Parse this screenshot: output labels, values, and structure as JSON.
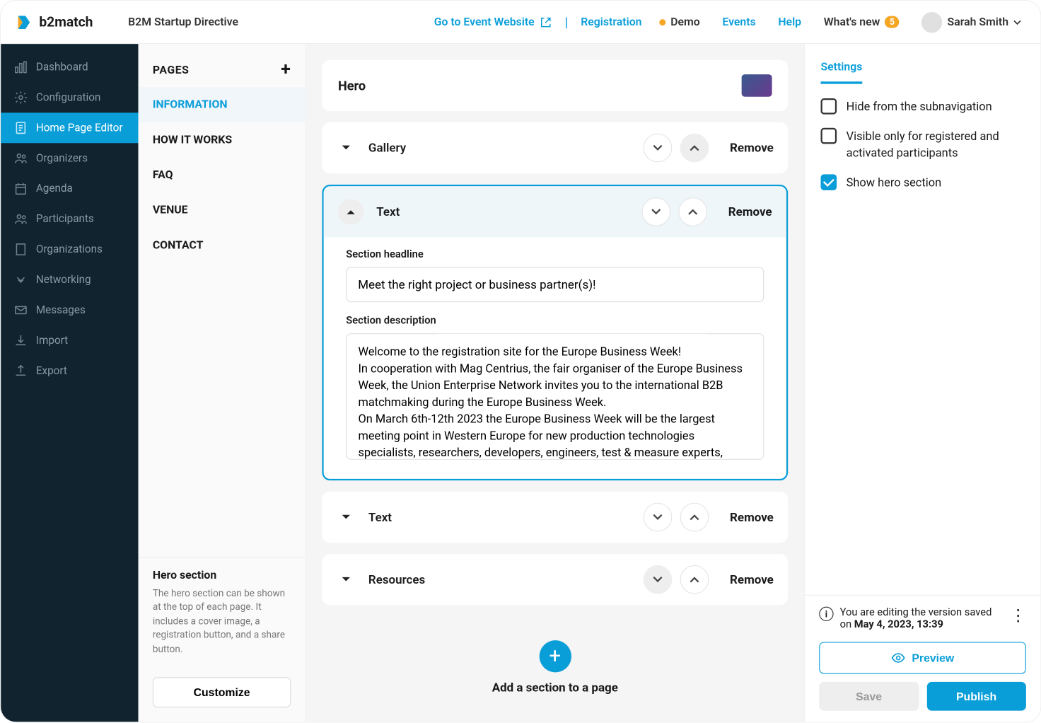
{
  "topbar": {
    "brand": "b2match",
    "event_title": "B2M Startup Directive",
    "go_to_website": "Go to Event Website",
    "registration": "Registration",
    "demo": "Demo",
    "events": "Events",
    "help": "Help",
    "whats_new": "What's new",
    "whats_new_count": "5",
    "user_name": "Sarah Smith"
  },
  "sidebar": {
    "items": [
      {
        "label": "Dashboard",
        "icon": "chart"
      },
      {
        "label": "Configuration",
        "icon": "gear"
      },
      {
        "label": "Home Page Editor",
        "icon": "doc",
        "active": true
      },
      {
        "label": "Organizers",
        "icon": "users"
      },
      {
        "label": "Agenda",
        "icon": "calendar"
      },
      {
        "label": "Participants",
        "icon": "users"
      },
      {
        "label": "Organizations",
        "icon": "building"
      },
      {
        "label": "Networking",
        "icon": "handshake"
      },
      {
        "label": "Messages",
        "icon": "mail"
      },
      {
        "label": "Import",
        "icon": "import"
      },
      {
        "label": "Export",
        "icon": "export"
      }
    ]
  },
  "pages_panel": {
    "title": "PAGES",
    "items": [
      {
        "label": "INFORMATION",
        "active": true
      },
      {
        "label": "HOW IT WORKS"
      },
      {
        "label": "FAQ"
      },
      {
        "label": "VENUE"
      },
      {
        "label": "CONTACT"
      }
    ],
    "hero_info": {
      "title": "Hero section",
      "desc": "The hero section can be shown at the top of each page. It includes a cover image, a registration button, and a share button."
    },
    "customize": "Customize"
  },
  "canvas": {
    "hero_title": "Hero",
    "sections": [
      {
        "label": "Gallery",
        "remove": "Remove",
        "down_disabled": false,
        "up_disabled": true
      },
      {
        "label": "Text",
        "remove": "Remove",
        "expanded": true,
        "headline_label": "Section headline",
        "headline_value": "Meet the right project or business partner(s)!",
        "desc_label": "Section description",
        "desc_value": "Welcome to the registration site for the Europe Business Week!\nIn cooperation with Mag Centrius, the fair organiser of the Europe Business Week, the Union Enterprise Network invites you to the international B2B matchmaking during the Europe Business Week.\nOn March 6th-12th 2023 the Europe Business Week will be the largest meeting point in Western Europe for new production technologies specialists, researchers, developers, engineers, test & measure experts, "
      },
      {
        "label": "Text",
        "remove": "Remove"
      },
      {
        "label": "Resources",
        "remove": "Remove",
        "down_disabled": true
      }
    ],
    "add_section": "Add a section to a page"
  },
  "settings": {
    "tab": "Settings",
    "options": [
      {
        "label": "Hide from the subnavigation",
        "checked": false
      },
      {
        "label": "Visible only for registered and activated participants",
        "checked": false
      },
      {
        "label": "Show hero section",
        "checked": true
      }
    ],
    "version_prefix": "You are editing the version saved on ",
    "version_date": "May 4, 2023, 13:39",
    "preview": "Preview",
    "save": "Save",
    "publish": "Publish"
  }
}
